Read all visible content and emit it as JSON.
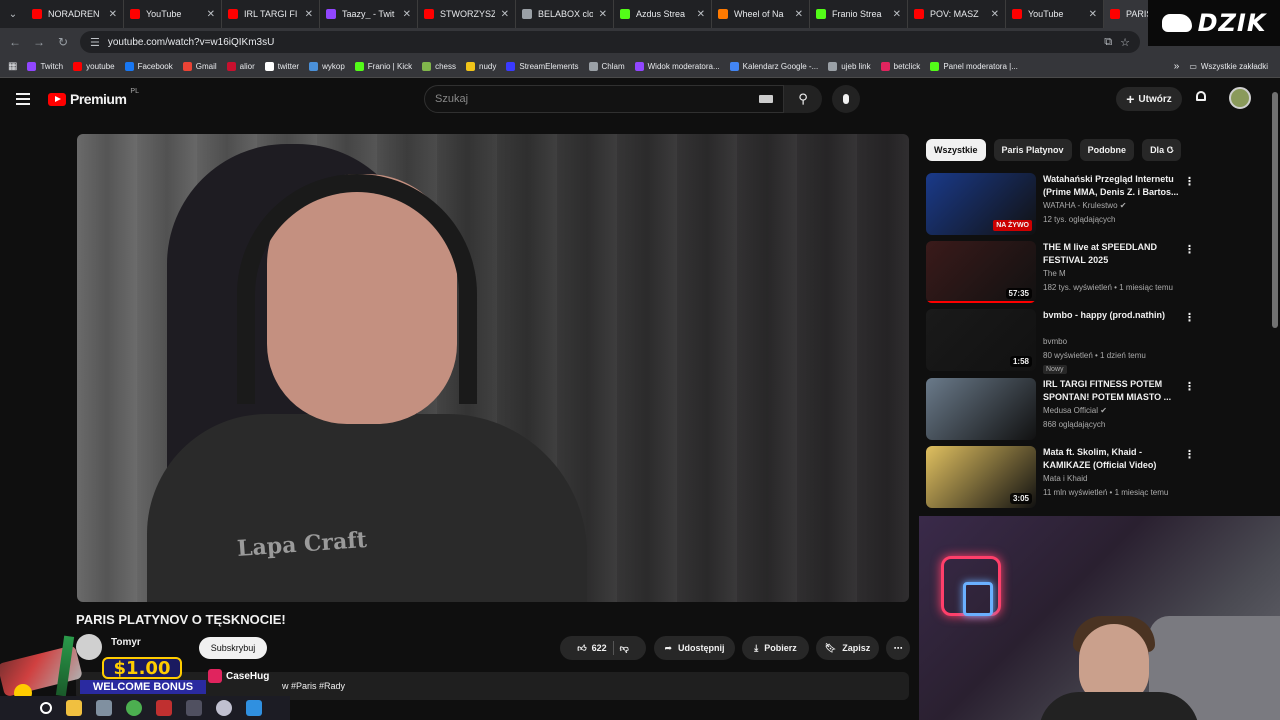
{
  "browser": {
    "tabs": [
      {
        "label": "NORADREN",
        "color": "#ff0000"
      },
      {
        "label": "YouTube",
        "color": "#ff0000"
      },
      {
        "label": "IRL TARGI FI",
        "color": "#ff0000"
      },
      {
        "label": "Taazy_ - Twit",
        "color": "#9146ff"
      },
      {
        "label": "STWORZYSZ",
        "color": "#ff0000"
      },
      {
        "label": "BELABOX clo",
        "color": "#9aa0a6"
      },
      {
        "label": "Azdus Strea",
        "color": "#53fc18"
      },
      {
        "label": "Wheel of Na",
        "color": "#ff7a00"
      },
      {
        "label": "Franio Strea",
        "color": "#53fc18"
      },
      {
        "label": "POV: MASZ",
        "color": "#ff0000"
      },
      {
        "label": "YouTube",
        "color": "#ff0000"
      },
      {
        "label": "PARIS PL",
        "color": "#ff0000",
        "active": true
      }
    ],
    "url": "youtube.com/watch?v=w16iQIKm3sU",
    "bookmarks": [
      {
        "label": "Twitch",
        "color": "#9146ff"
      },
      {
        "label": "youtube",
        "color": "#ff0000"
      },
      {
        "label": "Facebook",
        "color": "#1877f2"
      },
      {
        "label": "Gmail",
        "color": "#ea4335"
      },
      {
        "label": "alior",
        "color": "#c8102e"
      },
      {
        "label": "twitter",
        "color": "#ffffff"
      },
      {
        "label": "wykop",
        "color": "#4a90d9"
      },
      {
        "label": "Franio | Kick",
        "color": "#53fc18"
      },
      {
        "label": "chess",
        "color": "#81b64c"
      },
      {
        "label": "nudy",
        "color": "#f0c419"
      },
      {
        "label": "StreamElements",
        "color": "#3a3aff"
      },
      {
        "label": "Chlam",
        "color": "#9aa0a6"
      },
      {
        "label": "Widok moderatora...",
        "color": "#9146ff"
      },
      {
        "label": "Kalendarz Google -...",
        "color": "#4285f4"
      },
      {
        "label": "ujeb link",
        "color": "#9aa0a6"
      },
      {
        "label": "betclick",
        "color": "#e0245e"
      },
      {
        "label": "Panel moderatora |...",
        "color": "#53fc18"
      }
    ],
    "all_bookmarks": "Wszystkie zakładki"
  },
  "overlay_logo": "DZIK",
  "youtube": {
    "logo": "Premium",
    "logo_country": "PL",
    "search_placeholder": "Szukaj",
    "create_label": "Utwórz",
    "video": {
      "title": "PARIS PLATYNOV O TĘSKNOCIE!",
      "shirt_text": "Lapa Craft",
      "channel": "Tomyr",
      "subscribe": "Subskrybuj",
      "likes": "622",
      "share": "Udostępnij",
      "download": "Pobierz",
      "save": "Zapisz",
      "hashtags": "w #Paris #Rady"
    },
    "chips": [
      "Wszystkie",
      "Paris Platynov",
      "Podobne",
      "Dla C"
    ],
    "recommendations": [
      {
        "title": "Watahański Przegląd Internetu (Prime MMA, Denis Z. i Bartos...",
        "channel": "WATAHA - Krulestwo",
        "verified": true,
        "meta": "12 tys. oglądających",
        "badge_live": "NA ŻYWO",
        "thumb": "#1a3a8a"
      },
      {
        "title": "THE M live at SPEEDLAND FESTIVAL 2025",
        "channel": "The M",
        "meta": "182 tys. wyświetleń • 1 miesiąc temu",
        "duration": "57:35",
        "thumb": "#3a1a1a",
        "progress": 1.0
      },
      {
        "title": "bvmbo - happy (prod.nathin)",
        "channel": "bvmbo",
        "meta": "80 wyświetleń • 1 dzień temu",
        "badge": "Nowy",
        "duration": "1:58",
        "thumb": "#1a1a1a"
      },
      {
        "title": "IRL TARGI FITNESS POTEM SPONTAN! POTEM MIASTO ...",
        "channel": "Medusa Official",
        "verified": true,
        "meta": "868 oglądających",
        "thumb": "#6a7a8a"
      },
      {
        "title": "Mata ft. Skolim, Khaid - KAMIKAZE (Official Video)",
        "channel": "Mata i Khaid",
        "meta": "11 mln wyświetleń • 1 miesiąc temu",
        "duration": "3:05",
        "thumb": "#e0c060"
      }
    ]
  },
  "ad": {
    "amount": "$1.00",
    "bonus": "WELCOME BONUS",
    "brand": "CaseHug"
  }
}
